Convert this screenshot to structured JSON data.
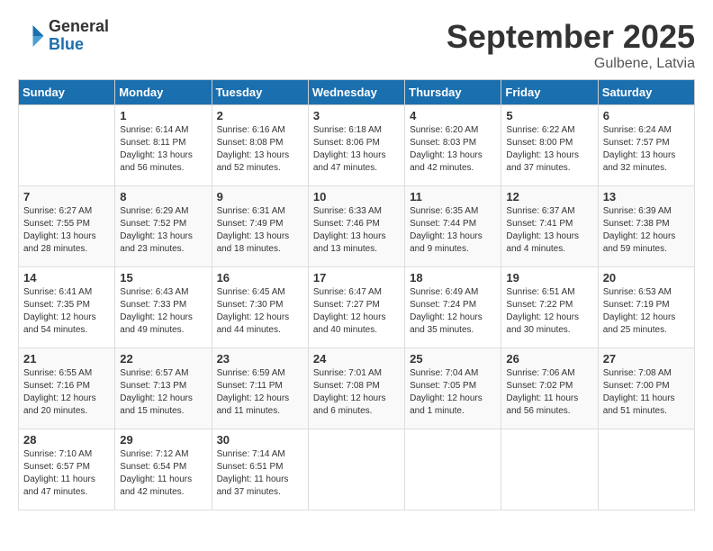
{
  "logo": {
    "general": "General",
    "blue": "Blue"
  },
  "header": {
    "month": "September 2025",
    "location": "Gulbene, Latvia"
  },
  "weekdays": [
    "Sunday",
    "Monday",
    "Tuesday",
    "Wednesday",
    "Thursday",
    "Friday",
    "Saturday"
  ],
  "weeks": [
    [
      {
        "day": "",
        "sunrise": "",
        "sunset": "",
        "daylight": ""
      },
      {
        "day": "1",
        "sunrise": "Sunrise: 6:14 AM",
        "sunset": "Sunset: 8:11 PM",
        "daylight": "Daylight: 13 hours and 56 minutes."
      },
      {
        "day": "2",
        "sunrise": "Sunrise: 6:16 AM",
        "sunset": "Sunset: 8:08 PM",
        "daylight": "Daylight: 13 hours and 52 minutes."
      },
      {
        "day": "3",
        "sunrise": "Sunrise: 6:18 AM",
        "sunset": "Sunset: 8:06 PM",
        "daylight": "Daylight: 13 hours and 47 minutes."
      },
      {
        "day": "4",
        "sunrise": "Sunrise: 6:20 AM",
        "sunset": "Sunset: 8:03 PM",
        "daylight": "Daylight: 13 hours and 42 minutes."
      },
      {
        "day": "5",
        "sunrise": "Sunrise: 6:22 AM",
        "sunset": "Sunset: 8:00 PM",
        "daylight": "Daylight: 13 hours and 37 minutes."
      },
      {
        "day": "6",
        "sunrise": "Sunrise: 6:24 AM",
        "sunset": "Sunset: 7:57 PM",
        "daylight": "Daylight: 13 hours and 32 minutes."
      }
    ],
    [
      {
        "day": "7",
        "sunrise": "Sunrise: 6:27 AM",
        "sunset": "Sunset: 7:55 PM",
        "daylight": "Daylight: 13 hours and 28 minutes."
      },
      {
        "day": "8",
        "sunrise": "Sunrise: 6:29 AM",
        "sunset": "Sunset: 7:52 PM",
        "daylight": "Daylight: 13 hours and 23 minutes."
      },
      {
        "day": "9",
        "sunrise": "Sunrise: 6:31 AM",
        "sunset": "Sunset: 7:49 PM",
        "daylight": "Daylight: 13 hours and 18 minutes."
      },
      {
        "day": "10",
        "sunrise": "Sunrise: 6:33 AM",
        "sunset": "Sunset: 7:46 PM",
        "daylight": "Daylight: 13 hours and 13 minutes."
      },
      {
        "day": "11",
        "sunrise": "Sunrise: 6:35 AM",
        "sunset": "Sunset: 7:44 PM",
        "daylight": "Daylight: 13 hours and 9 minutes."
      },
      {
        "day": "12",
        "sunrise": "Sunrise: 6:37 AM",
        "sunset": "Sunset: 7:41 PM",
        "daylight": "Daylight: 13 hours and 4 minutes."
      },
      {
        "day": "13",
        "sunrise": "Sunrise: 6:39 AM",
        "sunset": "Sunset: 7:38 PM",
        "daylight": "Daylight: 12 hours and 59 minutes."
      }
    ],
    [
      {
        "day": "14",
        "sunrise": "Sunrise: 6:41 AM",
        "sunset": "Sunset: 7:35 PM",
        "daylight": "Daylight: 12 hours and 54 minutes."
      },
      {
        "day": "15",
        "sunrise": "Sunrise: 6:43 AM",
        "sunset": "Sunset: 7:33 PM",
        "daylight": "Daylight: 12 hours and 49 minutes."
      },
      {
        "day": "16",
        "sunrise": "Sunrise: 6:45 AM",
        "sunset": "Sunset: 7:30 PM",
        "daylight": "Daylight: 12 hours and 44 minutes."
      },
      {
        "day": "17",
        "sunrise": "Sunrise: 6:47 AM",
        "sunset": "Sunset: 7:27 PM",
        "daylight": "Daylight: 12 hours and 40 minutes."
      },
      {
        "day": "18",
        "sunrise": "Sunrise: 6:49 AM",
        "sunset": "Sunset: 7:24 PM",
        "daylight": "Daylight: 12 hours and 35 minutes."
      },
      {
        "day": "19",
        "sunrise": "Sunrise: 6:51 AM",
        "sunset": "Sunset: 7:22 PM",
        "daylight": "Daylight: 12 hours and 30 minutes."
      },
      {
        "day": "20",
        "sunrise": "Sunrise: 6:53 AM",
        "sunset": "Sunset: 7:19 PM",
        "daylight": "Daylight: 12 hours and 25 minutes."
      }
    ],
    [
      {
        "day": "21",
        "sunrise": "Sunrise: 6:55 AM",
        "sunset": "Sunset: 7:16 PM",
        "daylight": "Daylight: 12 hours and 20 minutes."
      },
      {
        "day": "22",
        "sunrise": "Sunrise: 6:57 AM",
        "sunset": "Sunset: 7:13 PM",
        "daylight": "Daylight: 12 hours and 15 minutes."
      },
      {
        "day": "23",
        "sunrise": "Sunrise: 6:59 AM",
        "sunset": "Sunset: 7:11 PM",
        "daylight": "Daylight: 12 hours and 11 minutes."
      },
      {
        "day": "24",
        "sunrise": "Sunrise: 7:01 AM",
        "sunset": "Sunset: 7:08 PM",
        "daylight": "Daylight: 12 hours and 6 minutes."
      },
      {
        "day": "25",
        "sunrise": "Sunrise: 7:04 AM",
        "sunset": "Sunset: 7:05 PM",
        "daylight": "Daylight: 12 hours and 1 minute."
      },
      {
        "day": "26",
        "sunrise": "Sunrise: 7:06 AM",
        "sunset": "Sunset: 7:02 PM",
        "daylight": "Daylight: 11 hours and 56 minutes."
      },
      {
        "day": "27",
        "sunrise": "Sunrise: 7:08 AM",
        "sunset": "Sunset: 7:00 PM",
        "daylight": "Daylight: 11 hours and 51 minutes."
      }
    ],
    [
      {
        "day": "28",
        "sunrise": "Sunrise: 7:10 AM",
        "sunset": "Sunset: 6:57 PM",
        "daylight": "Daylight: 11 hours and 47 minutes."
      },
      {
        "day": "29",
        "sunrise": "Sunrise: 7:12 AM",
        "sunset": "Sunset: 6:54 PM",
        "daylight": "Daylight: 11 hours and 42 minutes."
      },
      {
        "day": "30",
        "sunrise": "Sunrise: 7:14 AM",
        "sunset": "Sunset: 6:51 PM",
        "daylight": "Daylight: 11 hours and 37 minutes."
      },
      {
        "day": "",
        "sunrise": "",
        "sunset": "",
        "daylight": ""
      },
      {
        "day": "",
        "sunrise": "",
        "sunset": "",
        "daylight": ""
      },
      {
        "day": "",
        "sunrise": "",
        "sunset": "",
        "daylight": ""
      },
      {
        "day": "",
        "sunrise": "",
        "sunset": "",
        "daylight": ""
      }
    ]
  ]
}
